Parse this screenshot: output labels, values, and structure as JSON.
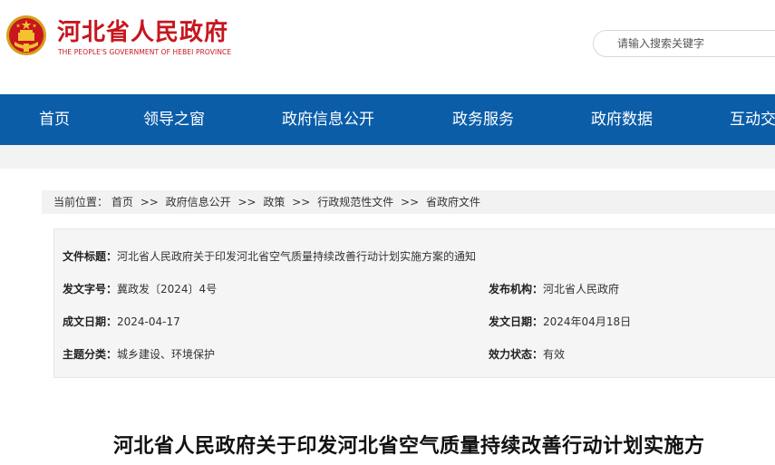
{
  "header": {
    "title": "河北省人民政府",
    "subtitle": "THE PEOPLE'S GOVERNMENT OF HEBEI PROVINCE",
    "emblem_icon": "national-emblem-icon",
    "search_placeholder": "请输入搜索关键字"
  },
  "nav": {
    "items": [
      {
        "label": "首页"
      },
      {
        "label": "领导之窗"
      },
      {
        "label": "政府信息公开"
      },
      {
        "label": "政务服务"
      },
      {
        "label": "政府数据"
      },
      {
        "label": "互动交"
      }
    ]
  },
  "breadcrumb": {
    "prefix": "当前位置：",
    "separator": ">>",
    "items": [
      "首页",
      "政府信息公开",
      "政策",
      "行政规范性文件",
      "省政府文件"
    ]
  },
  "info": {
    "title_label": "文件标题：",
    "title_value": "河北省人民政府关于印发河北省空气质量持续改善行动计划实施方案的通知",
    "doc_no_label": "发文字号：",
    "doc_no_value": "冀政发〔2024〕4号",
    "issuer_label": "发布机构：",
    "issuer_value": "河北省人民政府",
    "written_date_label": "成文日期：",
    "written_date_value": "2024-04-17",
    "publish_date_label": "发文日期：",
    "publish_date_value": "2024年04月18日",
    "category_label": "主题分类：",
    "category_value": "城乡建设、环境保护",
    "status_label": "效力状态：",
    "status_value": "有效"
  },
  "article": {
    "title": "河北省人民政府关于印发河北省空气质量持续改善行动计划实施方"
  },
  "colors": {
    "brand_red": "#c7161e",
    "nav_blue": "#0b5da8"
  }
}
